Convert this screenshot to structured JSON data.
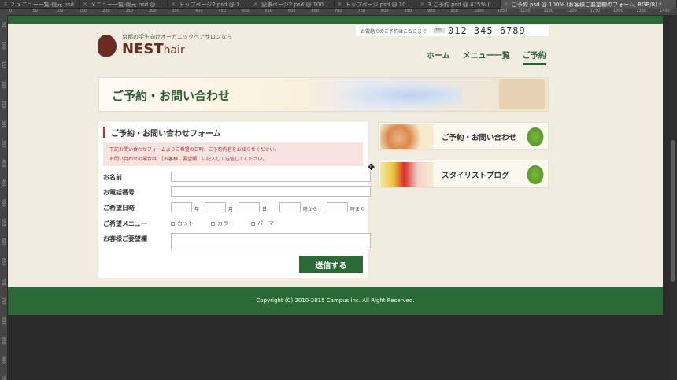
{
  "tabs": [
    "2.メニュー一覧-復元.psd",
    "メニュー一覧-復元.psd @ ...",
    "トップページ2.psd @ 1...",
    "記事ページ2.psd @ 100...",
    "トップページ.psd @ 10...",
    "3.ご予約.psd @ 415% (...",
    "ご予約.psd @ 100% (お客様ご要望欄のフォーム, RGB/8) *"
  ],
  "ruler_top_ticks": [
    "0",
    "50",
    "100",
    "150",
    "200",
    "250",
    "300",
    "350",
    "400",
    "450",
    "500",
    "550",
    "600",
    "650",
    "700",
    "750",
    "800",
    "850",
    "900",
    "950",
    "1000",
    "1050",
    "1100",
    "1150",
    "1200",
    "1250",
    "1300",
    "1350",
    "1400"
  ],
  "ruler_left_ticks": [
    "50",
    "100",
    "150",
    "200",
    "250",
    "300",
    "350",
    "400",
    "450",
    "500",
    "550",
    "600",
    "650",
    "700",
    "750",
    "800",
    "850",
    "900",
    "950"
  ],
  "header": {
    "contact_text": "お電話でのご予約はこちらまで",
    "tel_label": "TEL",
    "tel_number": "012-345-6789",
    "logo_tagline": "京都の学生向けオーガニックヘアサロンなら",
    "logo_name": "NEST",
    "logo_suffix": "hair"
  },
  "nav": [
    "ホーム",
    "メニュー一覧",
    "ご予約"
  ],
  "banner_title": "ご予約・お問い合わせ",
  "form": {
    "title": "ご予約・お問い合わせフォーム",
    "notice_line1": "下記お問い合わせフォームよりご希望の日時、ご予約内容をお知らせください。",
    "notice_line2": "お問い合わせの場合は、［お客様ご要望欄］に記入して送信してください。",
    "label_name": "お名前",
    "label_phone": "お電話番号",
    "label_date": "ご希望日時",
    "unit_year": "年",
    "unit_month": "月",
    "unit_day": "日",
    "unit_from": "時から",
    "unit_to": "時まで",
    "label_menu": "ご希望メニュー",
    "menu_options": [
      "カット",
      "カラー",
      "パーマ"
    ],
    "label_request": "お客様ご要望欄",
    "submit": "送信する"
  },
  "side": [
    "ご予約・お問い合わせ",
    "スタイリストブログ"
  ],
  "footer": "Copyright (C) 2010-2015 Campus inc. All Right Reserved.",
  "colors": {
    "brand_green": "#2b6a36",
    "accent_red": "#c3302c",
    "logo_brown": "#6b2a22"
  }
}
